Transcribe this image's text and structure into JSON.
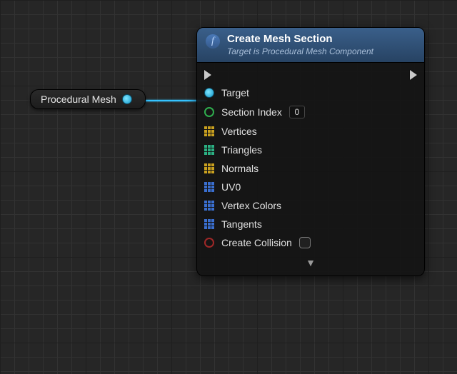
{
  "source_node": {
    "label": "Procedural Mesh"
  },
  "node": {
    "title": "Create Mesh Section",
    "subtitle": "Target is Procedural Mesh Component",
    "pins": {
      "target": "Target",
      "section_index": {
        "label": "Section Index",
        "value": "0"
      },
      "vertices": "Vertices",
      "triangles": "Triangles",
      "normals": "Normals",
      "uv0": "UV0",
      "vertex_colors": "Vertex Colors",
      "tangents": "Tangents",
      "create_collision": "Create Collision"
    }
  }
}
